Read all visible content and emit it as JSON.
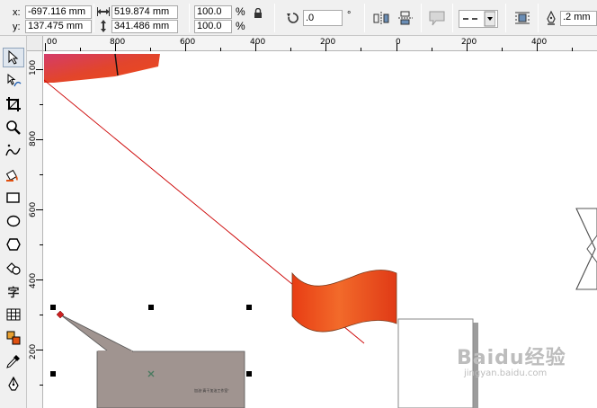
{
  "propbar": {
    "x_label": "x:",
    "x_value": "-697.116 mm",
    "y_label": "y:",
    "y_value": "137.475 mm",
    "width_value": "519.874 mm",
    "height_value": "341.486 mm",
    "scale_x": "100.0",
    "scale_y": "100.0",
    "percent": "%",
    "rotation_value": ".0",
    "degree": "°",
    "outline_width": ".2 mm"
  },
  "ruler_h": {
    "labels": [
      "00",
      "800",
      "600",
      "400",
      "200",
      "0",
      "200",
      "400"
    ]
  },
  "ruler_v": {
    "labels": [
      "100",
      "800",
      "600",
      "400",
      "200"
    ]
  },
  "toolbox": {
    "text_tool_glyph": "字"
  },
  "canvas": {
    "callout_text": "加油“真干加油工作室”",
    "watermark_main": "Baidu经验",
    "watermark_sub": "jingyan.baidu.com"
  },
  "colors": {
    "flag_orange": "#ee4a18",
    "flag_red": "#e03820",
    "callout_fill": "#a09490",
    "guide_line": "#cc0000",
    "handle_red": "#cc2020"
  }
}
